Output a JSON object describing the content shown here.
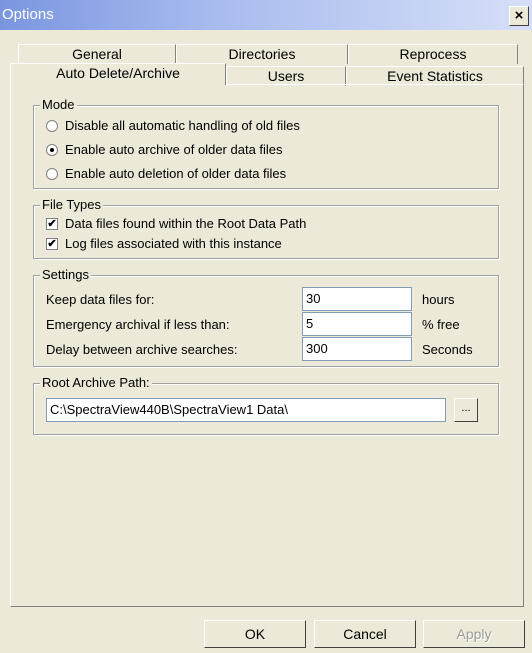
{
  "window": {
    "title": "Options",
    "close_glyph": "×"
  },
  "tabs": {
    "row1": [
      "General",
      "Directories",
      "Reprocess"
    ],
    "row2": [
      "Auto Delete/Archive",
      "Users",
      "Event Statistics"
    ],
    "active": "Auto Delete/Archive"
  },
  "mode": {
    "label": "Mode",
    "options": [
      {
        "label": "Disable all automatic handling of old files",
        "selected": false
      },
      {
        "label": "Enable auto archive of older data files",
        "selected": true
      },
      {
        "label": "Enable auto deletion of older data files",
        "selected": false
      }
    ]
  },
  "file_types": {
    "label": "File Types",
    "items": [
      {
        "label": "Data files found within the Root Data Path",
        "checked": true,
        "mark": "✔"
      },
      {
        "label": "Log files associated with this instance",
        "checked": true,
        "mark": "✔"
      }
    ]
  },
  "settings": {
    "label": "Settings",
    "rows": [
      {
        "label": "Keep data files for:",
        "value": "30",
        "unit": "hours"
      },
      {
        "label": "Emergency archival if less than:",
        "value": "5",
        "unit": "% free"
      },
      {
        "label": "Delay between archive searches:",
        "value": "300",
        "unit": "Seconds"
      }
    ]
  },
  "root_archive": {
    "label": "Root Archive Path:",
    "value": "C:\\SpectraView440B\\SpectraView1 Data\\",
    "browse_label": "..."
  },
  "buttons": {
    "ok": "OK",
    "cancel": "Cancel",
    "apply": "Apply",
    "apply_enabled": false
  }
}
